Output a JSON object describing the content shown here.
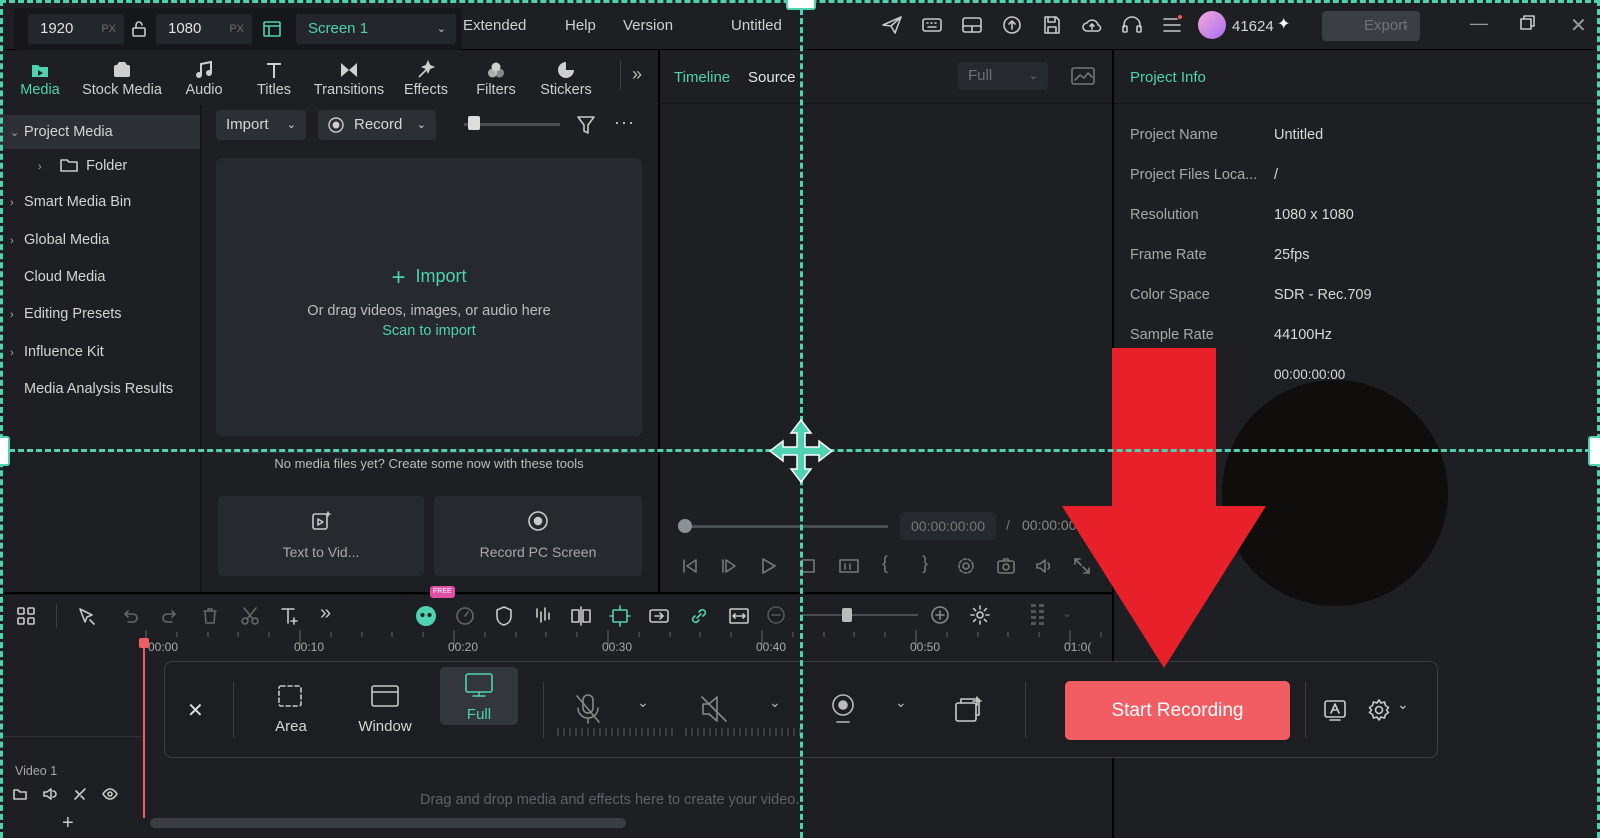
{
  "screen_size": {
    "width": "1920",
    "height": "1080",
    "unit": "PX",
    "screen": "Screen 1"
  },
  "menu": {
    "extended": "Extended",
    "help": "Help",
    "version": "Version",
    "title": "Untitled",
    "credits": "41624",
    "export": "Export"
  },
  "nav_tabs": [
    {
      "label": "Media",
      "icon": "media-icon"
    },
    {
      "label": "Stock Media",
      "icon": "stock-media-icon"
    },
    {
      "label": "Audio",
      "icon": "audio-icon"
    },
    {
      "label": "Titles",
      "icon": "titles-icon"
    },
    {
      "label": "Transitions",
      "icon": "transitions-icon"
    },
    {
      "label": "Effects",
      "icon": "effects-icon"
    },
    {
      "label": "Filters",
      "icon": "filters-icon"
    },
    {
      "label": "Stickers",
      "icon": "stickers-icon"
    }
  ],
  "sidebar": {
    "items": [
      {
        "label": "Project Media"
      },
      {
        "label": "Folder"
      },
      {
        "label": "Smart Media Bin"
      },
      {
        "label": "Global Media"
      },
      {
        "label": "Cloud Media"
      },
      {
        "label": "Editing Presets"
      },
      {
        "label": "Influence Kit"
      },
      {
        "label": "Media Analysis Results"
      }
    ]
  },
  "media_toolbar": {
    "import": "Import",
    "record": "Record"
  },
  "dropzone": {
    "import": "Import",
    "hint": "Or drag videos, images, or audio here",
    "scan": "Scan to import"
  },
  "tools": {
    "hint": "No media files yet? Create some now with these tools",
    "text_to_video": "Text to Vid...",
    "record_pc": "Record PC Screen"
  },
  "player": {
    "tab_timeline": "Timeline",
    "tab_source": "Source",
    "quality": "Full",
    "current_time": "00:00:00:00",
    "separator": "/",
    "total_time": "00:00:00"
  },
  "project_info": {
    "title": "Project Info",
    "rows": [
      {
        "label": "Project Name",
        "value": "Untitled"
      },
      {
        "label": "Project Files Loca...",
        "value": "/"
      },
      {
        "label": "Resolution",
        "value": "1080 x 1080"
      },
      {
        "label": "Frame Rate",
        "value": "25fps"
      },
      {
        "label": "Color Space",
        "value": "SDR - Rec.709"
      },
      {
        "label": "Sample Rate",
        "value": "44100Hz"
      },
      {
        "label": "",
        "value": "00:00:00:00"
      }
    ]
  },
  "timeline": {
    "ticks": [
      "00:00",
      "00:10",
      "00:20",
      "00:30",
      "00:40",
      "00:50",
      "01:0("
    ],
    "track_label": "Video 1",
    "drop_hint": "Drag and drop media and effects here to create your video.",
    "badge": "FREE"
  },
  "recorder": {
    "modes": [
      {
        "label": "Area",
        "icon": "area-icon"
      },
      {
        "label": "Window",
        "icon": "window-icon"
      },
      {
        "label": "Full",
        "icon": "full-screen-icon",
        "selected": true
      }
    ],
    "start": "Start Recording"
  },
  "colors": {
    "accent": "#4fd2b2",
    "record": "#f25c63",
    "arrow": "#e8202a",
    "panel": "#1d1f22"
  }
}
